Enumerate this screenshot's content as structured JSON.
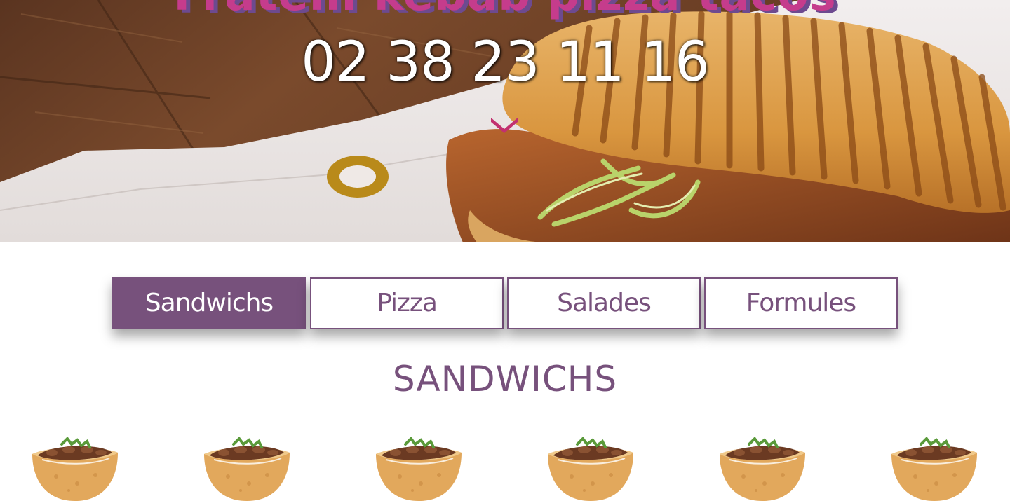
{
  "hero": {
    "title": "Fratelli kebab pizza tacos",
    "phone": "02 38 23 11 16",
    "scroll_icon": "chevron-down-icon"
  },
  "tabs": [
    {
      "label": "Sandwichs",
      "active": true
    },
    {
      "label": "Pizza",
      "active": false
    },
    {
      "label": "Salades",
      "active": false
    },
    {
      "label": "Formules",
      "active": false
    }
  ],
  "section": {
    "title": "SANDWICHS"
  },
  "products": [
    {
      "image": "kebab-sandwich-image"
    },
    {
      "image": "kebab-sandwich-image"
    },
    {
      "image": "kebab-sandwich-image"
    },
    {
      "image": "kebab-sandwich-image"
    },
    {
      "image": "kebab-sandwich-image"
    },
    {
      "image": "kebab-sandwich-image"
    }
  ],
  "colors": {
    "accent": "#77517c",
    "title_pink": "#c53c8c",
    "chevron": "#c2306f"
  }
}
